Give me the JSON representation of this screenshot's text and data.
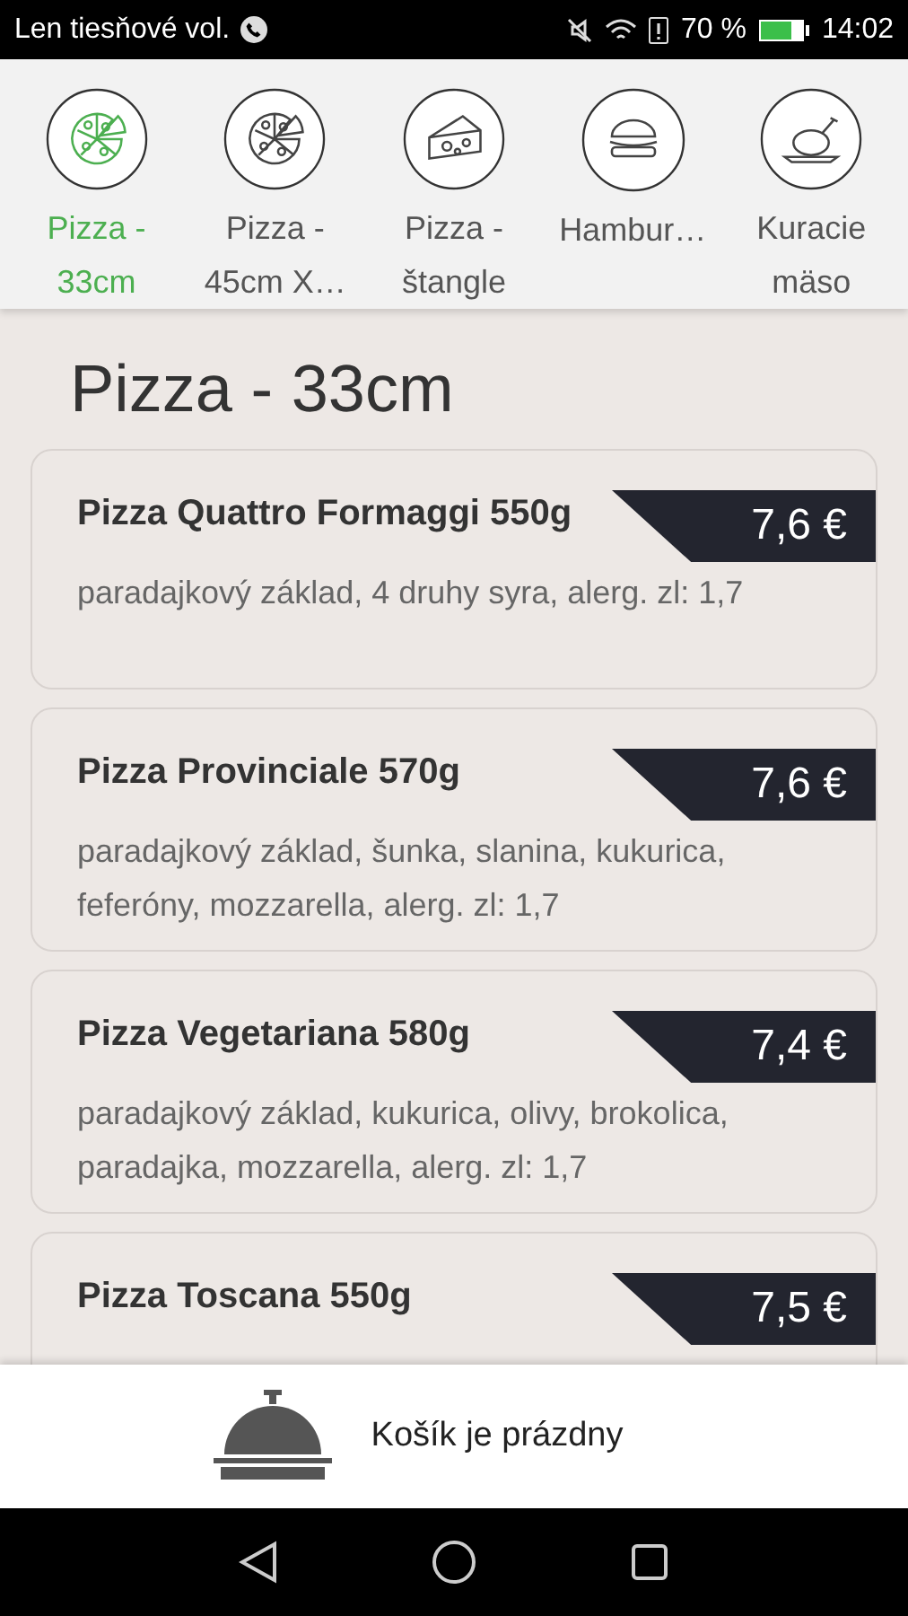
{
  "status_bar": {
    "carrier": "Len tiesňové vol.",
    "battery": "70 %",
    "time": "14:02"
  },
  "categories": [
    {
      "label": "Pizza -\n33cm",
      "kind": "pizza",
      "selected": true
    },
    {
      "label": "Pizza -\n45cm X…",
      "kind": "pizza",
      "selected": false
    },
    {
      "label": "Pizza -\nštangle",
      "kind": "cheese",
      "selected": false
    },
    {
      "label": "Hambur…",
      "kind": "burger",
      "selected": false
    },
    {
      "label": "Kuracie\nmäso",
      "kind": "chicken",
      "selected": false
    }
  ],
  "section_title": "Pizza - 33cm",
  "products": [
    {
      "name": "Pizza Quattro Formaggi 550g",
      "price": "7,6 €",
      "description": "paradajkový základ, 4 druhy syra, alerg. zl: 1,7"
    },
    {
      "name": "Pizza Provinciale 570g",
      "price": "7,6 €",
      "description": "paradajkový základ, šunka, slanina, kukurica, feferóny, mozzarella, alerg. zl: 1,7"
    },
    {
      "name": "Pizza Vegetariana 580g",
      "price": "7,4 €",
      "description": "paradajkový základ, kukurica, olivy, brokolica, paradajka, mozzarella, alerg. zl: 1,7"
    },
    {
      "name": "Pizza Toscana 550g",
      "price": "7,5 €"
    }
  ],
  "cart": {
    "label": "Košík je prázdny"
  }
}
